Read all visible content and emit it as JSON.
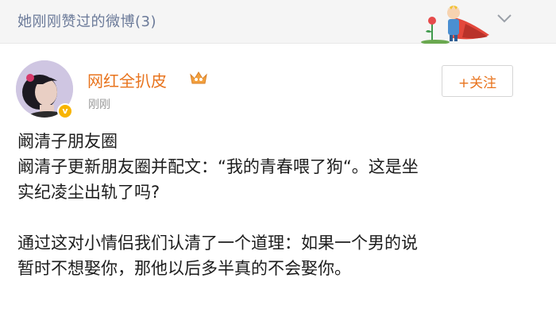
{
  "header": {
    "title": "她刚刚赞过的微博(3)",
    "illustration_icon": "little-prince-illustration",
    "collapse_icon": "chevron-down-icon"
  },
  "post": {
    "author": {
      "name": "网红全扒皮",
      "avatar_icon": "avatar-portrait",
      "verified_icon": "verified-badge-icon",
      "verified_glyph": "v",
      "vip_icon": "vip-crown-icon"
    },
    "time": "刚刚",
    "follow_label": "+关注",
    "lines": [
      "阚清子朋友圈",
      "阚清子更新朋友圈并配文：“我的青春喂了狗“。这是坐",
      "实纪凌尘出轨了吗?",
      "",
      "通过这对小情侣我们认清了一个道理：如果一个男的说",
      "暂时不想娶你，那他以后多半真的不会娶你。"
    ]
  },
  "colors": {
    "header_text": "#6b7a99",
    "username": "#e8741e",
    "follow_text": "#e8741e",
    "badge": "#f8b400"
  }
}
